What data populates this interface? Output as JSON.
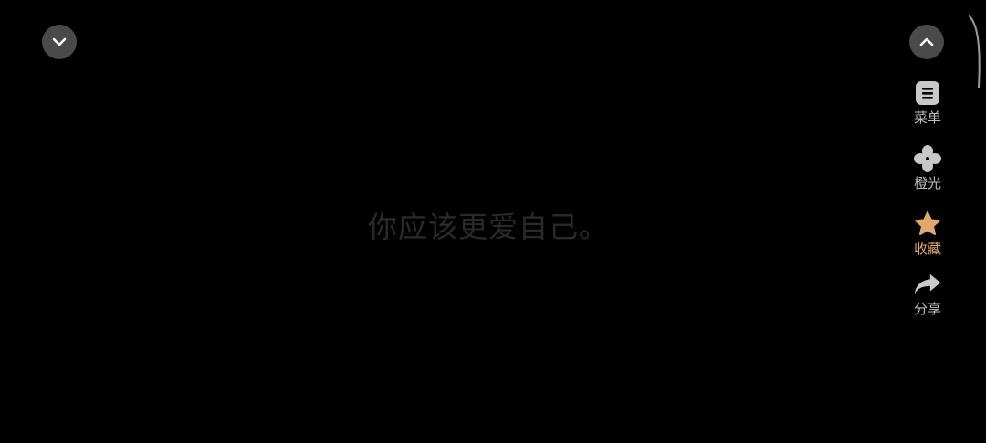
{
  "lyric": {
    "text": "你应该更爱自己。"
  },
  "controls": {
    "collapse_icon": "chevron-down-icon",
    "expand_icon": "chevron-up-icon"
  },
  "side_actions": [
    {
      "label": "菜单",
      "icon": "menu-list-icon"
    },
    {
      "label": "橙光",
      "icon": "orange-clover-icon"
    },
    {
      "label": "收藏",
      "icon": "star-icon",
      "active": true
    },
    {
      "label": "分享",
      "icon": "share-arrow-icon"
    }
  ],
  "colors": {
    "background": "#000000",
    "button_bg": "#4a4a4a",
    "label": "#bdbdbd",
    "accent": "#e0a86a",
    "lyric": "#2a2a2a"
  }
}
